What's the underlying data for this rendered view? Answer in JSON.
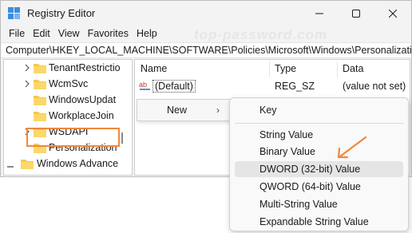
{
  "window": {
    "title": "Registry Editor"
  },
  "menubar": {
    "items": [
      "File",
      "Edit",
      "View",
      "Favorites",
      "Help"
    ]
  },
  "watermark": "top-password.com",
  "address": {
    "path": "Computer\\HKEY_LOCAL_MACHINE\\SOFTWARE\\Policies\\Microsoft\\Windows\\Personalization"
  },
  "tree": {
    "items": [
      {
        "label": "TenantRestrictio",
        "expandable": true
      },
      {
        "label": "WcmSvc",
        "expandable": true
      },
      {
        "label": "WindowsUpdat",
        "expandable": false
      },
      {
        "label": "WorkplaceJoin",
        "expandable": false
      },
      {
        "label": "WSDAPI",
        "expandable": true
      },
      {
        "label": "Personalization",
        "expandable": false,
        "selected": true
      },
      {
        "label": "Windows Advance",
        "expandable": false
      }
    ]
  },
  "list": {
    "headers": {
      "name": "Name",
      "type": "Type",
      "data": "Data"
    },
    "rows": [
      {
        "name": "(Default)",
        "type": "REG_SZ",
        "data": "(value not set)"
      }
    ]
  },
  "context_menu": {
    "new_label": "New",
    "arrow": "›"
  },
  "submenu": {
    "items": [
      "Key",
      "String Value",
      "Binary Value",
      "DWORD (32-bit) Value",
      "QWORD (64-bit) Value",
      "Multi-String Value",
      "Expandable String Value"
    ],
    "highlighted": "DWORD (32-bit) Value"
  },
  "colors": {
    "accent_orange": "#f0883c",
    "folder_yellow": "#f7c94c",
    "highlight": "#e5e5e5"
  }
}
